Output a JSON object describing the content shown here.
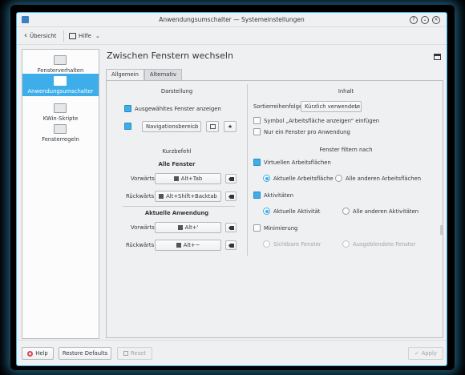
{
  "window": {
    "title": "Anwendungsumschalter — Systemeinstellungen"
  },
  "toolbar": {
    "back_label": "Übersicht",
    "help_label": "Hilfe"
  },
  "sidebar": {
    "items": [
      {
        "label": "Fensterverhalten"
      },
      {
        "label": "Anwendungsumschalter"
      },
      {
        "label": "KWin-Skripte"
      },
      {
        "label": "Fensterregeln"
      }
    ]
  },
  "page": {
    "title": "Zwischen Fenstern wechseln",
    "tabs": [
      "Allgemein",
      "Alternativ"
    ]
  },
  "left": {
    "darstellung": "Darstellung",
    "show_selected_window": "Ausgewähltes Fenster anzeigen",
    "style_value": "Navigationsbereich",
    "kurzbefehl": "Kurzbefehl",
    "all_windows": "Alle Fenster",
    "current_app": "Aktuelle Anwendung",
    "forward": "Vorwärts",
    "backward": "Rückwärts",
    "keys": {
      "all_forward": "Alt+Tab",
      "all_backward": "Alt+Shift+Backtab",
      "app_forward": "Alt+'",
      "app_backward": "Alt+~"
    }
  },
  "right": {
    "inhalt": "Inhalt",
    "sort_label": "Sortierreihenfolge:",
    "sort_value": "Kürzlich verwendete",
    "show_desktop_symbol": "Symbol „Arbeitsfläche anzeigen\" einfügen",
    "one_per_app": "Nur ein Fenster pro Anwendung",
    "filter_header": "Fenster filtern nach",
    "virtual_desktops": "Virtuellen Arbeitsflächen",
    "current_desktop": "Aktuelle Arbeitsfläche",
    "all_other_desktops": "Alle anderen Arbeitsflächen",
    "activities": "Aktivitäten",
    "current_activity": "Aktuelle Aktivität",
    "all_other_activities": "Alle anderen Aktivitäten",
    "minimization": "Minimierung",
    "visible_windows": "Sichtbare Fenster",
    "hidden_windows": "Ausgeblendete Fenster"
  },
  "footer": {
    "help": "Help",
    "restore_defaults": "Restore Defaults",
    "reset": "Reset",
    "apply": "Apply"
  },
  "colors": {
    "accent": "#3daee9",
    "window_bg": "#eff0f1",
    "text": "#31363b"
  }
}
